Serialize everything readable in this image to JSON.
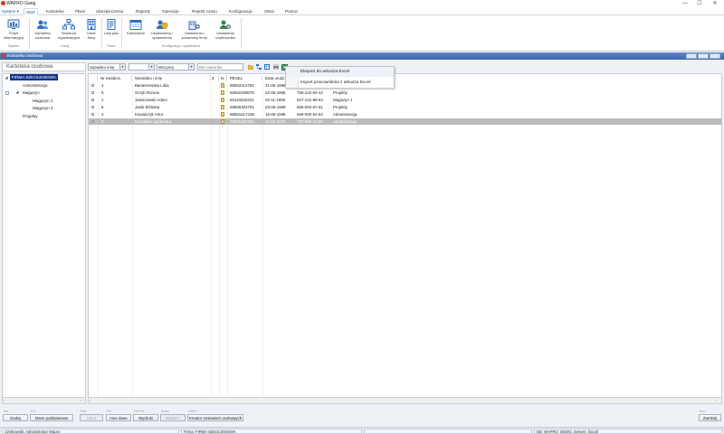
{
  "window": {
    "app_title": "WAPRO Gang",
    "minimize": "—",
    "maximize": "☐",
    "close": "✕"
  },
  "menu_tabs": [
    {
      "label": "System"
    },
    {
      "label": "Start"
    },
    {
      "label": "Kartoteka"
    },
    {
      "label": "Płace"
    },
    {
      "label": "Ubezpieczenia"
    },
    {
      "label": "Raporty"
    },
    {
      "label": "Operacje"
    },
    {
      "label": "Rejestr czasu"
    },
    {
      "label": "Konfiguracja"
    },
    {
      "label": "Okna"
    },
    {
      "label": "Pomoc"
    }
  ],
  "ribbon": {
    "buttons": [
      {
        "label": "Pulpit informacyjny"
      },
      {
        "label": "Kartoteka osobowa"
      },
      {
        "label": "Struktura organizacyjna"
      },
      {
        "label": "Dane firmy"
      },
      {
        "label": "Listy płac"
      },
      {
        "label": "Kalendarze"
      },
      {
        "label": "Użytkownicy i uprawnienia"
      },
      {
        "label": "Ustawienia i parametry firmy"
      },
      {
        "label": "Ustawienia użytkownika"
      }
    ],
    "groups": [
      {
        "label": "System"
      },
      {
        "label": "Kadry"
      },
      {
        "label": "Płace"
      },
      {
        "label": "Konfiguracja i uprawnienia"
      }
    ]
  },
  "subwindow": {
    "title": "Kartoteka osobowa"
  },
  "left_panel": {
    "header": "Kartoteka osobowa"
  },
  "tree": [
    {
      "label": "FIRMA SZKOLENIOWA"
    },
    {
      "label": "Administracja"
    },
    {
      "label": "Magazyn"
    },
    {
      "label": "Magazyn 1"
    },
    {
      "label": "Magazyn 2"
    },
    {
      "label": "Projekty"
    }
  ],
  "filters": {
    "sort_select": "nazwisko imię",
    "status_select": "Wszyscy",
    "search_placeholder": "Bez warunku"
  },
  "dropdown_menu": [
    {
      "label": "Eksport do arkusza Excel"
    },
    {
      "label": "Import pracowników z arkusza Excel"
    }
  ],
  "grid": {
    "columns": [
      "Nr ewidenc.",
      "Nazwisko i imię",
      "Z",
      "N",
      "PESEL",
      "Data urodz."
    ],
    "rows": [
      {
        "nr": "4",
        "name": "Banaszewska Lidia",
        "pesel": "88053114763",
        "birth": "31-05-1988",
        "phone": "",
        "dept": ""
      },
      {
        "nr": "5",
        "name": "Grzyb Roman",
        "pesel": "65062208075",
        "birth": "22-06-1965",
        "phone": "755-122-64-42",
        "dept": "Projekty"
      },
      {
        "nr": "1",
        "name": "Janiszewski Adam",
        "pesel": "56110252231",
        "birth": "02-11-1956",
        "phone": "527-142-89-53",
        "dept": "Magazyn 1"
      },
      {
        "nr": "6",
        "name": "Janik Elżbieta",
        "pesel": "69060304701",
        "birth": "03-06-1969",
        "phone": "566-094-67-51",
        "dept": "Projekty"
      },
      {
        "nr": "2",
        "name": "Kowalczyk Artur",
        "pesel": "88061617239",
        "birth": "16-06-1988",
        "phone": "669-000-62-64",
        "dept": "Administracja"
      },
      {
        "nr": "3",
        "name": "Kowalska Agnieszka",
        "pesel": "79031207366",
        "birth": "12-03-1979",
        "phone": "737-099-13-09",
        "dept": "Administracja"
      }
    ]
  },
  "footer_keys": [
    {
      "key": "Ins",
      "label": "Dodaj"
    },
    {
      "key": "F2",
      "label": "Dane podstawowe"
    },
    {
      "key": "Del",
      "label": "Usuń"
    },
    {
      "key": "F5",
      "label": "Inne dane"
    },
    {
      "key": "Ctrl+D",
      "label": "Wydruki"
    },
    {
      "key": "Enter",
      "label": "Wybierz"
    },
    {
      "key": "Ctrl+I",
      "label": "Kreator zestawień osobowych"
    },
    {
      "key": "Esc",
      "label": "Zamknij"
    }
  ],
  "status": {
    "user": "Użytkownik: Administrator Wapro",
    "company": "Firma: FIRMA SZKOLENIOWA",
    "db": "BD: WAPRO_DEMO, Serwer: (local)"
  }
}
